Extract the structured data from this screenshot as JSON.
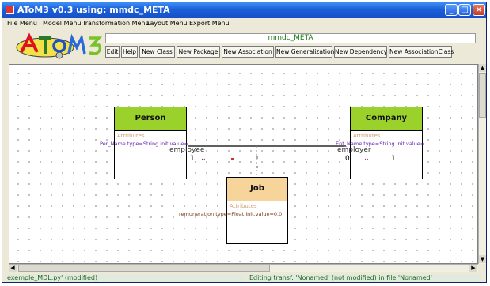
{
  "window": {
    "title": "AToM3 v0.3 using: mmdc_META"
  },
  "menu": [
    {
      "label": "File Menu"
    },
    {
      "label": "Model Menu"
    },
    {
      "label": "Transformation Menu"
    },
    {
      "label": "Layout Menu"
    },
    {
      "label": "Export Menu"
    }
  ],
  "toolbar": {
    "model_name": "mmdc_META",
    "buttons": [
      {
        "label": "Edit"
      },
      {
        "label": "Help"
      },
      {
        "label": "New Class"
      },
      {
        "label": "New Package"
      },
      {
        "label": "New Association"
      },
      {
        "label": "New Generalization"
      },
      {
        "label": "New Dependency"
      },
      {
        "label": "New AssociationClass"
      }
    ]
  },
  "diagram": {
    "classes": [
      {
        "name": "Person",
        "header_color": "#9ad12a",
        "section": "Attributes",
        "attribute": "Per_Name type=String init.value="
      },
      {
        "name": "Company",
        "header_color": "#9ad12a",
        "section": "Attributes",
        "attribute": "Ent_Name type=String init.value="
      },
      {
        "name": "Job",
        "header_color": "#f6d49a",
        "section": "Attributes",
        "attribute": "remuneration type=Float init.value=0.0"
      }
    ],
    "association": {
      "left_role": "employee",
      "right_role": "employer",
      "left_mult": "1",
      "left_mark": "..",
      "right_mult_a": "0",
      "right_mark": "..",
      "right_mult_b": "1"
    }
  },
  "statusbar": {
    "left": "exemple_MDL.py' (modified)",
    "right": "Editing transf. 'Nonamed' (not modified) in file 'Nonamed'"
  },
  "colors": {
    "title_blue": "#1550c8",
    "class_green": "#9ad12a",
    "job_header": "#f6d49a",
    "attribute_purple": "#5a1aa8",
    "attribute_brown": "#7a3a1a"
  }
}
